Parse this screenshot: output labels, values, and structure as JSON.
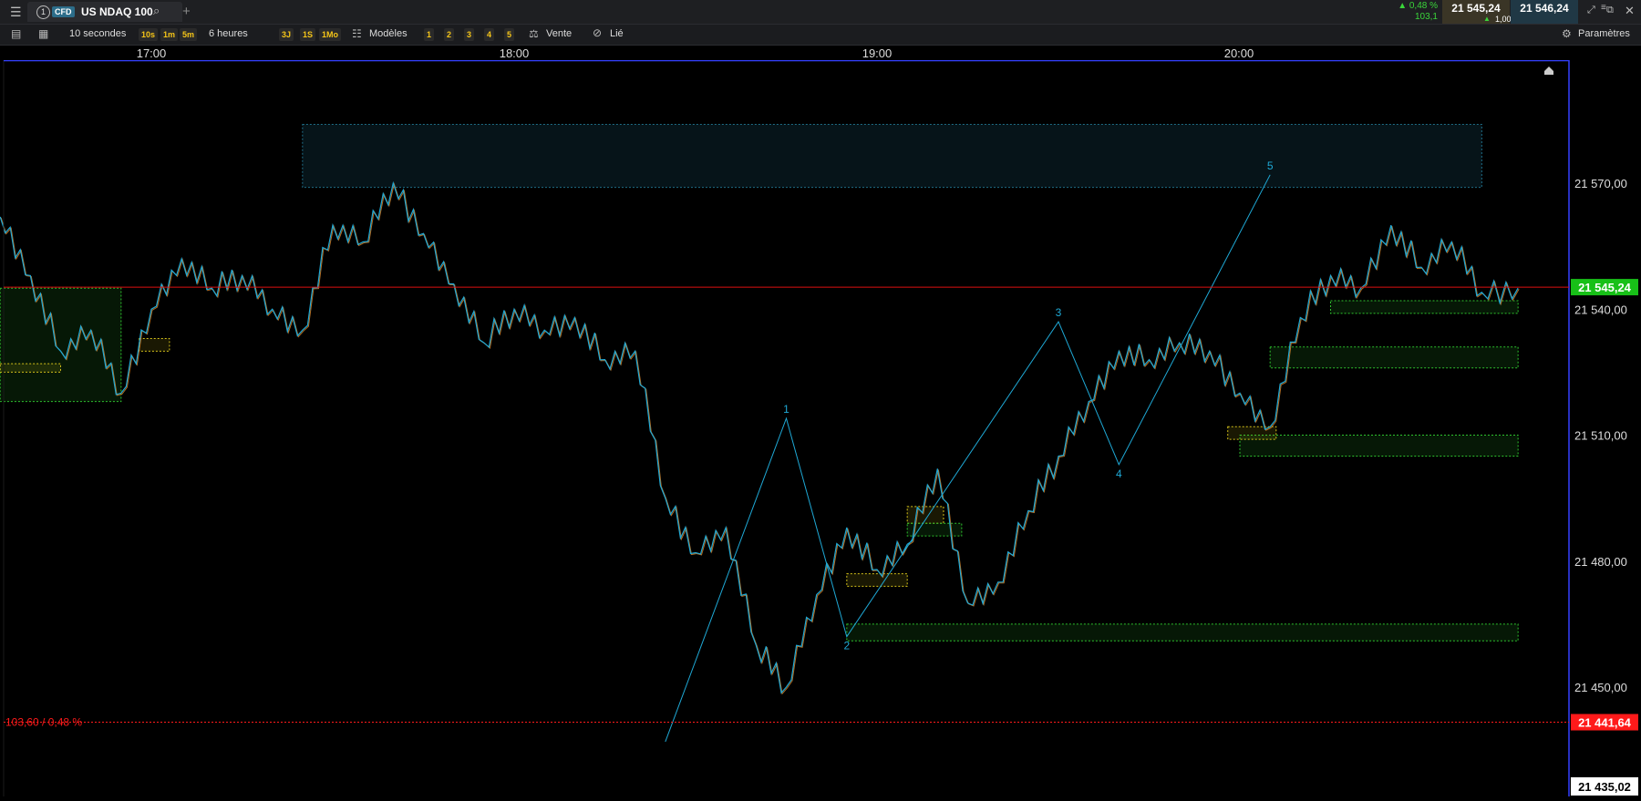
{
  "titlebar": {
    "tab_number": "1",
    "instrument_type": "CFD",
    "instrument_name": "US NDAQ 100",
    "change_pct": "▲ 0,48 %",
    "change_abs": "103,1",
    "bid": "21 545,24",
    "ask": "21 546,24",
    "spread": "1,00"
  },
  "toolbar": {
    "interval": "10 secondes",
    "interval_quick": [
      "10s",
      "1m",
      "5m"
    ],
    "range": "6 heures",
    "range_quick": [
      "3J",
      "1S",
      "1Mo"
    ],
    "templates_label": "Modèles",
    "template_slots": [
      "1",
      "2",
      "3",
      "4",
      "5"
    ],
    "trade_label": "Vente",
    "link_label": "Lié",
    "settings_label": "Paramètres"
  },
  "chart_data": {
    "type": "line",
    "x_axis": {
      "unit": "time",
      "ticks": [
        "17:00",
        "18:00",
        "19:00",
        "20:00"
      ],
      "range": [
        "16:35",
        "20:46"
      ]
    },
    "y_axis": {
      "ticks": [
        "21 570,00",
        "21 540,00",
        "21 510,00",
        "21 480,00",
        "21 450,00"
      ],
      "tick_values": [
        21570,
        21540,
        21510,
        21480,
        21450
      ],
      "range": [
        21435.02,
        21585
      ],
      "position": "right"
    },
    "last_price": {
      "value": 21545.24,
      "label": "21 545,24",
      "color": "#18c018"
    },
    "low_marker": {
      "value": 21441.64,
      "label": "21 441,64",
      "color": "#ff1a1a",
      "change_label": "103,60 / 0,48 %"
    },
    "bottom_price": {
      "value": 21435.02,
      "label": "21 435,02"
    },
    "series": [
      {
        "color": "#1fa9d6",
        "x": [
          "16:35",
          "16:40",
          "16:45",
          "16:50",
          "16:55",
          "17:00",
          "17:05",
          "17:10",
          "17:15",
          "17:20",
          "17:25",
          "17:30",
          "17:35",
          "17:40",
          "17:45",
          "17:50",
          "17:55",
          "18:00",
          "18:05",
          "18:10",
          "18:15",
          "18:20",
          "18:25",
          "18:30",
          "18:35",
          "18:40",
          "18:45",
          "18:50",
          "18:55",
          "19:00",
          "19:05",
          "19:10",
          "19:15",
          "19:20",
          "19:25",
          "19:30",
          "19:35",
          "19:40",
          "19:45",
          "19:50",
          "19:55",
          "20:00",
          "20:05",
          "20:10",
          "20:15",
          "20:20",
          "20:25",
          "20:30",
          "20:35",
          "20:40",
          "20:46"
        ],
        "values": [
          21562,
          21548,
          21530,
          21535,
          21520,
          21540,
          21552,
          21545,
          21548,
          21540,
          21535,
          21560,
          21556,
          21570,
          21558,
          21546,
          21532,
          21540,
          21535,
          21538,
          21528,
          21530,
          21495,
          21482,
          21488,
          21460,
          21450,
          21472,
          21488,
          21478,
          21484,
          21502,
          21470,
          21475,
          21492,
          21505,
          21518,
          21530,
          21528,
          21532,
          21530,
          21520,
          21512,
          21538,
          21548,
          21545,
          21560,
          21550,
          21556,
          21544,
          21545
        ]
      }
    ],
    "zones": [
      {
        "kind": "supply",
        "from": "17:25",
        "to": "20:40",
        "top": 21584,
        "bottom": 21569,
        "color": "#1f6f89"
      },
      {
        "kind": "demand",
        "from": "16:35",
        "to": "16:55",
        "top": 21545,
        "bottom": 21518,
        "color": "#2ec22e"
      },
      {
        "kind": "demand",
        "from": "18:55",
        "to": "20:46",
        "top": 21465,
        "bottom": 21461,
        "color": "#2ec22e"
      },
      {
        "kind": "demand",
        "from": "20:00",
        "to": "20:46",
        "top": 21510,
        "bottom": 21505,
        "color": "#2ec22e"
      },
      {
        "kind": "demand",
        "from": "20:05",
        "to": "20:46",
        "top": 21531,
        "bottom": 21526,
        "color": "#2ec22e"
      },
      {
        "kind": "demand",
        "from": "20:15",
        "to": "20:46",
        "top": 21542,
        "bottom": 21539,
        "color": "#2ec22e"
      },
      {
        "kind": "order",
        "from": "16:35",
        "to": "16:45",
        "top": 21527,
        "bottom": 21525,
        "color": "#d6c21a"
      },
      {
        "kind": "order",
        "from": "16:58",
        "to": "17:03",
        "top": 21533,
        "bottom": 21530,
        "color": "#d6c21a"
      },
      {
        "kind": "order",
        "from": "18:55",
        "to": "19:05",
        "top": 21477,
        "bottom": 21474,
        "color": "#d6c21a"
      },
      {
        "kind": "order",
        "from": "19:05",
        "to": "19:11",
        "top": 21493,
        "bottom": 21489,
        "color": "#d6c21a"
      },
      {
        "kind": "order",
        "from": "19:05",
        "to": "19:14",
        "top": 21489,
        "bottom": 21486,
        "color": "#2ec22e"
      },
      {
        "kind": "order",
        "from": "19:58",
        "to": "20:06",
        "top": 21512,
        "bottom": 21509,
        "color": "#d6c21a"
      }
    ],
    "wave_labels": [
      "1",
      "2",
      "3",
      "4",
      "5"
    ],
    "wave_points": [
      {
        "label": "",
        "x": "18:25",
        "y": 21437
      },
      {
        "label": "1",
        "x": "18:45",
        "y": 21514
      },
      {
        "label": "2",
        "x": "18:55",
        "y": 21462
      },
      {
        "label": "3",
        "x": "19:30",
        "y": 21537
      },
      {
        "label": "4",
        "x": "19:40",
        "y": 21503
      },
      {
        "label": "5",
        "x": "20:05",
        "y": 21572
      }
    ]
  }
}
